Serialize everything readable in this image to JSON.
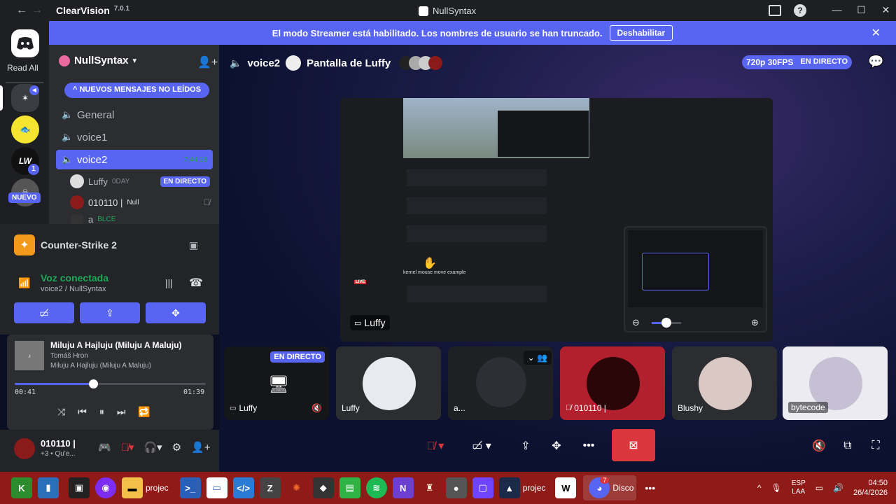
{
  "titlebar": {
    "app_name": "ClearVision",
    "app_version": "7.0.1",
    "window_title": "NullSyntax"
  },
  "streamer_banner": {
    "message": "El modo Streamer está habilitado. Los nombres de usuario se han truncado.",
    "button": "Deshabilitar"
  },
  "server_rail": {
    "read_all": "Read All",
    "new_label": "NUEVO",
    "badge_count": "1"
  },
  "sidebar": {
    "server_name": "NullSyntax",
    "new_messages_pill": "NUEVOS MENSAJES NO LEÍDOS",
    "channels": [
      {
        "name": "General"
      },
      {
        "name": "voice1"
      },
      {
        "name": "voice2",
        "timer": "7:44:18"
      }
    ],
    "voice_users": [
      {
        "name": "Luffy",
        "tag": "0DAY",
        "badge": "EN DIRECTO"
      },
      {
        "name": "010110 |",
        "tag": "Null"
      },
      {
        "name": "a",
        "tag": "BLCE"
      }
    ]
  },
  "activity": {
    "game": "Counter-Strike 2"
  },
  "voice_status": {
    "status": "Voz conectada",
    "location": "voice2 / NullSyntax"
  },
  "music": {
    "title": "Miluju A Hajluju (Miluju A Maluju)",
    "artist": "Tomáš Hron",
    "album": "Miluju A Hajluju (Miluju A Maluju)",
    "elapsed": "00:41",
    "duration": "01:39",
    "progress": 0.41
  },
  "user_panel": {
    "username": "010110 |",
    "status": "+3 • Qu'e..."
  },
  "call": {
    "channel": "voice2",
    "screen_share_title": "Pantalla de Luffy",
    "quality": "720p 30FPS",
    "live": "EN DIRECTO",
    "stream_owner": "Luffy",
    "zoom_level": 0.5
  },
  "tiles": [
    {
      "name": "Luffy",
      "live": "EN DIRECTO"
    },
    {
      "name": "Luffy"
    },
    {
      "name": "a..."
    },
    {
      "name": "010110 |"
    },
    {
      "name": "Blushy"
    },
    {
      "name": "bytecode"
    }
  ],
  "taskbar": {
    "items": [
      {
        "label": "projec"
      },
      {
        "label": "projec"
      },
      {
        "label": "Disco"
      }
    ],
    "lang": "ESP",
    "lang_sub": "LAA",
    "time": "04:50",
    "date": "26/4/2026",
    "discord_badge": "7"
  },
  "stream_content": {
    "caption": "kernel mouse move example",
    "live_tag": "LIVE"
  },
  "colors": {
    "blurple": "#5865f2",
    "taskbar": "#8e1b17",
    "danger": "#da373c"
  }
}
